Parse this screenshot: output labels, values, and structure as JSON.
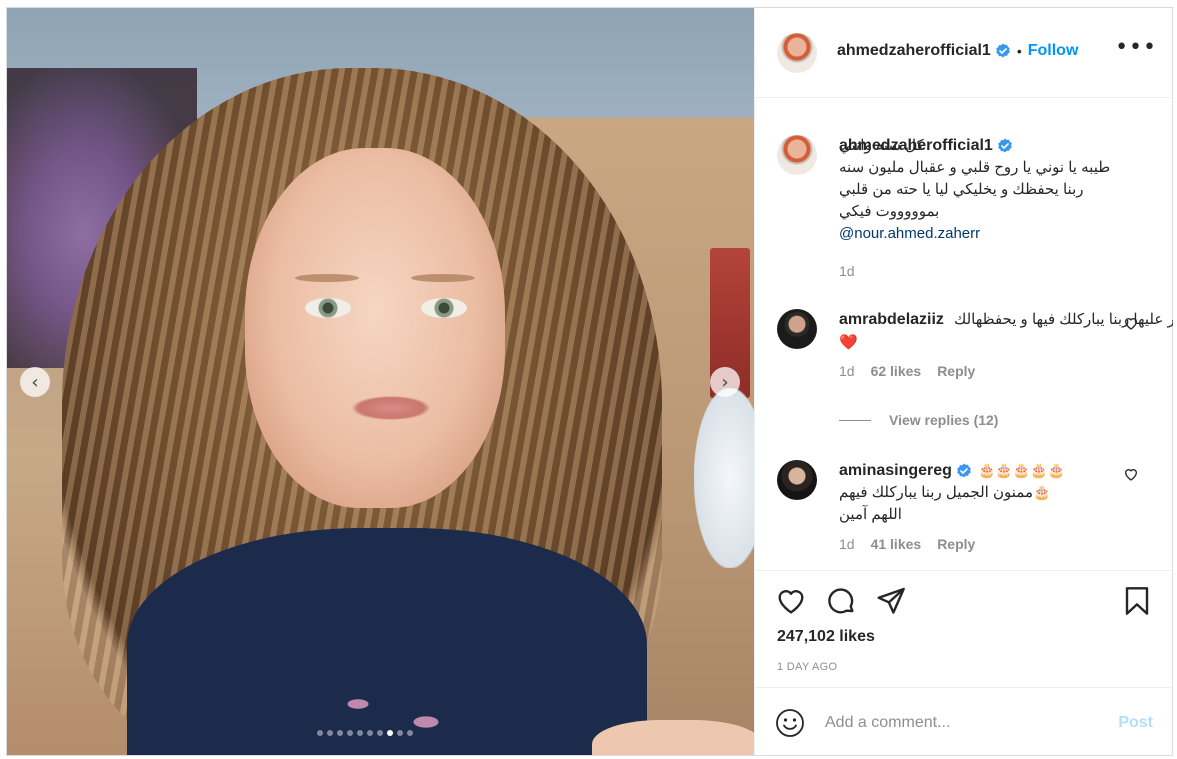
{
  "post": {
    "author": {
      "username": "ahmedzaherofficial1",
      "verified": true,
      "follow_label": "Follow",
      "separator": "•"
    },
    "carousel": {
      "prev_label": "‹",
      "next_label": "›",
      "slide_count": 10,
      "active_slide": 8
    },
    "caption": {
      "username": "ahmedzaherofficial1",
      "text": "كل سنه وانتي طيبه يا نوني يا روح قلبي و عقبال مليون سنه ربنا يحفظك و يخليكي ليا يا حته من قلبي بموووووت فيكي",
      "mention": "@nour.ahmed.zaherr",
      "time": "1d"
    },
    "comments": [
      {
        "username": "amrabdelaziiz",
        "verified": true,
        "text": "الله اكبر عليها ربنا يباركلك فيها و يحفظهالك",
        "emoji": "❤️",
        "time": "1d",
        "likes": "62 likes",
        "reply_label": "Reply",
        "view_replies": "View replies (12)"
      },
      {
        "username": "aminasingereg",
        "verified": true,
        "emoji_prefix": "🎂🎂🎂🎂🎂",
        "text": "ممنون الجميل ربنا يباركلك فيهم",
        "emoji_suffix": "🎂",
        "text2": "اللهم آمين",
        "time": "1d",
        "likes": "41 likes",
        "reply_label": "Reply"
      }
    ],
    "likes": "247,102 likes",
    "timestamp": "1 DAY AGO",
    "add_comment": {
      "placeholder": "Add a comment...",
      "post_label": "Post"
    },
    "more_label": "•••"
  },
  "colors": {
    "accent": "#0095f6",
    "verified": "#3897f0",
    "heart_red": "#ed4956",
    "muted": "#8e8e8e",
    "post_disabled": "#b2dffc"
  },
  "icons": [
    "verified-icon",
    "more-icon",
    "heart-icon",
    "comment-icon",
    "share-icon",
    "bookmark-icon",
    "emoji-icon",
    "chevron-left-icon",
    "chevron-right-icon"
  ]
}
